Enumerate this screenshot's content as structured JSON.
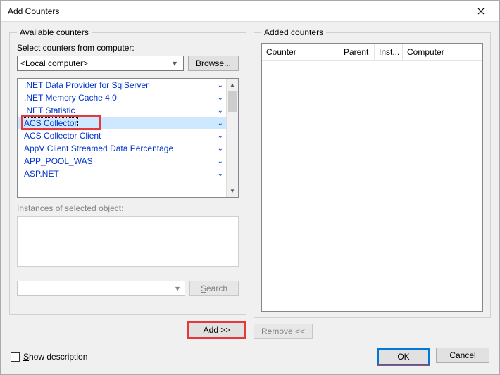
{
  "title": "Add Counters",
  "available": {
    "legend": "Available counters",
    "select_label": "Select counters from computer:",
    "computer": "<Local computer>",
    "browse": "Browse...",
    "counters": [
      ".NET Data Provider for SqlServer",
      ".NET Memory Cache 4.0",
      ".NET Statistic",
      "ACS Collector",
      "ACS Collector Client",
      "AppV Client Streamed Data Percentage",
      "APP_POOL_WAS",
      "ASP.NET"
    ],
    "selected_index": 3,
    "instances_label": "Instances of selected object:",
    "search": "Search",
    "add": "Add >>"
  },
  "added": {
    "legend": "Added counters",
    "headers": {
      "counter": "Counter",
      "parent": "Parent",
      "inst": "Inst...",
      "computer": "Computer"
    },
    "remove": "Remove <<"
  },
  "footer": {
    "show_description": "how description",
    "show_description_key": "S",
    "ok": "OK",
    "cancel": "Cancel"
  }
}
